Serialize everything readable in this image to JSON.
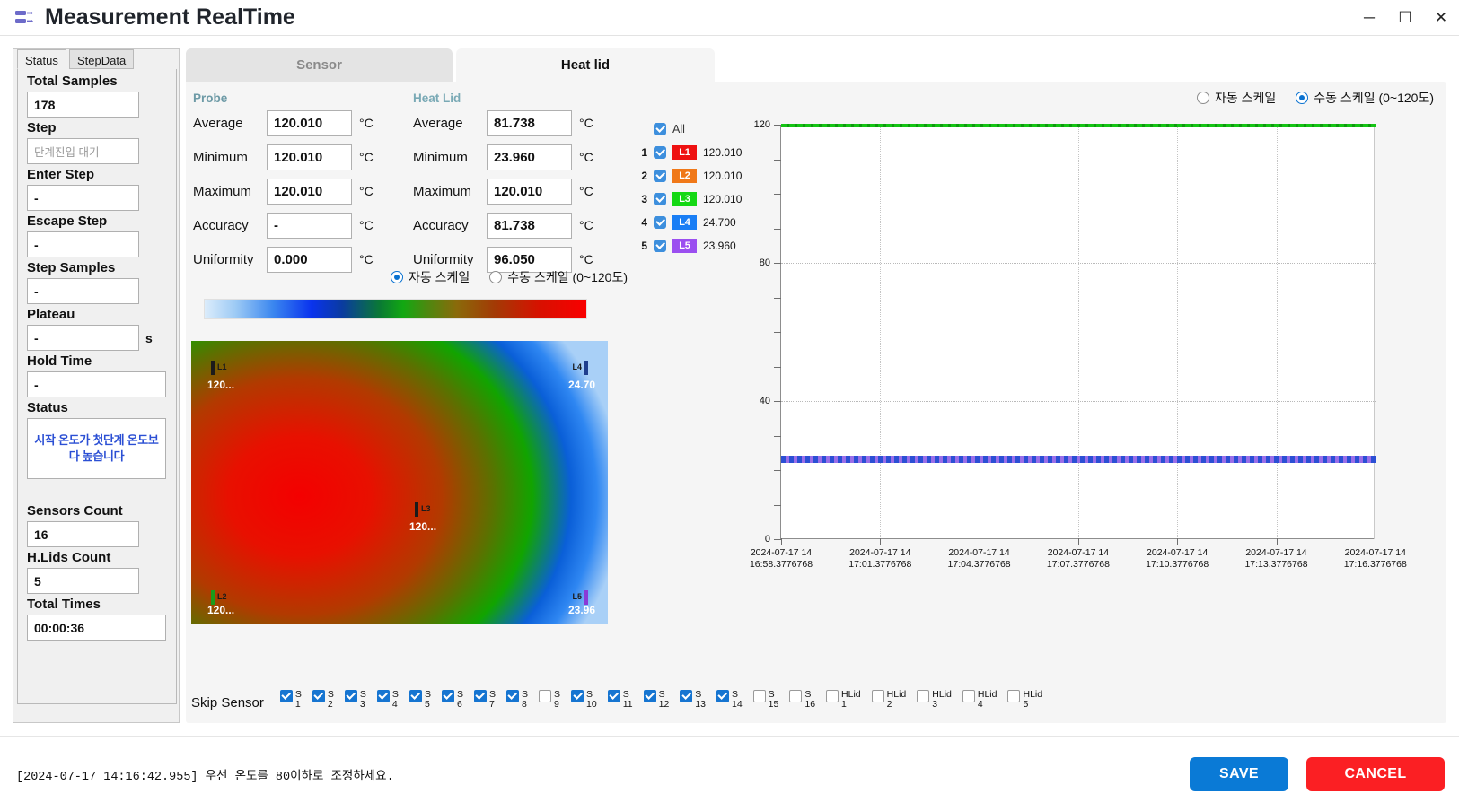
{
  "window": {
    "title": "Measurement RealTime",
    "icon": "devices-icon",
    "minimize": "─",
    "maximize": "☐",
    "close": "✕"
  },
  "sidebar": {
    "tabs": [
      {
        "label": "Status",
        "active": true
      },
      {
        "label": "StepData",
        "active": false
      }
    ],
    "fields": [
      {
        "label": "Total Samples",
        "value": "178",
        "placeholder": "",
        "unit": ""
      },
      {
        "label": "Step",
        "value": "",
        "placeholder": "단계진입 대기",
        "unit": ""
      },
      {
        "label": "Enter Step",
        "value": "-",
        "placeholder": "",
        "unit": ""
      },
      {
        "label": "Escape Step",
        "value": "-",
        "placeholder": "",
        "unit": ""
      },
      {
        "label": "Step Samples",
        "value": "-",
        "placeholder": "",
        "unit": ""
      },
      {
        "label": "Plateau",
        "value": "-",
        "placeholder": "",
        "unit": "s"
      },
      {
        "label": "Hold Time",
        "value": "-",
        "placeholder": "",
        "unit": ""
      }
    ],
    "status": {
      "label": "Status",
      "message": "시작 온도가 첫단계 온도보다 높습니다",
      "color": "#2b4fd4"
    },
    "counts": [
      {
        "label": "Sensors Count",
        "value": "16"
      },
      {
        "label": "H.Lids Count",
        "value": "5"
      },
      {
        "label": "Total Times",
        "value": "00:00:36"
      }
    ]
  },
  "tabs": [
    {
      "label": "Sensor",
      "active": false
    },
    {
      "label": "Heat lid",
      "active": true
    }
  ],
  "stats": {
    "probe": {
      "group": "Probe",
      "unit": "°C",
      "rows": [
        {
          "name": "Average",
          "value": "120.010"
        },
        {
          "name": "Minimum",
          "value": "120.010"
        },
        {
          "name": "Maximum",
          "value": "120.010"
        },
        {
          "name": "Accuracy",
          "value": "-"
        },
        {
          "name": "Uniformity",
          "value": "0.000"
        }
      ]
    },
    "heatlid": {
      "group": "Heat Lid",
      "unit": "°C",
      "rows": [
        {
          "name": "Average",
          "value": "81.738"
        },
        {
          "name": "Minimum",
          "value": "23.960"
        },
        {
          "name": "Maximum",
          "value": "120.010"
        },
        {
          "name": "Accuracy",
          "value": "81.738"
        },
        {
          "name": "Uniformity",
          "value": "96.050"
        }
      ]
    }
  },
  "scale_radios_heatmap": {
    "auto": {
      "label": "자동 스케일",
      "selected": true
    },
    "manual": {
      "label": "수동 스케일 (0~120도)",
      "selected": false
    }
  },
  "scale_radios_chart": {
    "auto": {
      "label": "자동 스케일",
      "selected": false
    },
    "manual": {
      "label": "수동 스케일 (0~120도)",
      "selected": true
    }
  },
  "legend": {
    "all_label": "All",
    "all_checked": true,
    "items": [
      {
        "index": "1",
        "name": "L1",
        "value": "120.010",
        "color": "#ee1111",
        "checked": true
      },
      {
        "index": "2",
        "name": "L2",
        "value": "120.010",
        "color": "#f07818",
        "checked": true
      },
      {
        "index": "3",
        "name": "L3",
        "value": "120.010",
        "color": "#14d814",
        "checked": true
      },
      {
        "index": "4",
        "name": "L4",
        "value": "24.700",
        "color": "#1a7ef5",
        "checked": true
      },
      {
        "index": "5",
        "name": "L5",
        "value": "23.960",
        "color": "#9b4ff0",
        "checked": true
      }
    ]
  },
  "heatmap": {
    "markers": [
      {
        "name": "L1",
        "value": "120...",
        "pos": "top-left",
        "tick_color": "#1b1b1b"
      },
      {
        "name": "L4",
        "value": "24.70",
        "pos": "top-right",
        "tick_color": "#1f3f8f"
      },
      {
        "name": "L3",
        "value": "120...",
        "pos": "center",
        "tick_color": "#1b1b1b"
      },
      {
        "name": "L2",
        "value": "120...",
        "pos": "bottom-left",
        "tick_color": "#1b9c1b"
      },
      {
        "name": "L5",
        "value": "23.96",
        "pos": "bottom-right",
        "tick_color": "#8a3ad6"
      }
    ]
  },
  "chart_data": {
    "type": "line",
    "title": "",
    "xlabel": "",
    "ylabel": "",
    "ylim": [
      0,
      120
    ],
    "yticks": [
      0,
      40,
      80,
      120
    ],
    "ytick_labels": [
      "0",
      "40",
      "80",
      "120"
    ],
    "grid": true,
    "legend_position": "left-external",
    "x": [
      "2024-07-17 14\n16:58.3776768",
      "2024-07-17 14\n17:01.3776768",
      "2024-07-17 14\n17:04.3776768",
      "2024-07-17 14\n17:07.3776768",
      "2024-07-17 14\n17:10.3776768",
      "2024-07-17 14\n17:13.3776768",
      "2024-07-17 14\n17:16.3776768"
    ],
    "xtick_labels": [
      [
        "2024-07-17 14",
        "16:58.3776768"
      ],
      [
        "2024-07-17 14",
        "17:01.3776768"
      ],
      [
        "2024-07-17 14",
        "17:04.3776768"
      ],
      [
        "2024-07-17 14",
        "17:07.3776768"
      ],
      [
        "2024-07-17 14",
        "17:10.3776768"
      ],
      [
        "2024-07-17 14",
        "17:13.3776768"
      ],
      [
        "2024-07-17 14",
        "17:16.3776768"
      ]
    ],
    "series": [
      {
        "name": "L1",
        "color": "#ee1111",
        "constant": 120.01,
        "values": [
          120.01,
          120.01,
          120.01,
          120.01,
          120.01,
          120.01,
          120.01
        ]
      },
      {
        "name": "L2",
        "color": "#f07818",
        "constant": 120.01,
        "values": [
          120.01,
          120.01,
          120.01,
          120.01,
          120.01,
          120.01,
          120.01
        ]
      },
      {
        "name": "L3",
        "color": "#14d814",
        "constant": 120.01,
        "values": [
          120.01,
          120.01,
          120.01,
          120.01,
          120.01,
          120.01,
          120.01
        ]
      },
      {
        "name": "L4",
        "color": "#1a7ef5",
        "constant": 24.7,
        "values": [
          24.7,
          24.7,
          24.7,
          24.7,
          24.7,
          24.7,
          24.7
        ]
      },
      {
        "name": "L5",
        "color": "#9b4ff0",
        "constant": 23.96,
        "values": [
          23.96,
          23.96,
          23.96,
          23.96,
          23.96,
          23.96,
          23.96
        ]
      }
    ]
  },
  "skip_sensor": {
    "label": "Skip Sensor",
    "items": [
      {
        "prefix": "S",
        "num": "1",
        "checked": true
      },
      {
        "prefix": "S",
        "num": "2",
        "checked": true
      },
      {
        "prefix": "S",
        "num": "3",
        "checked": true
      },
      {
        "prefix": "S",
        "num": "4",
        "checked": true
      },
      {
        "prefix": "S",
        "num": "5",
        "checked": true
      },
      {
        "prefix": "S",
        "num": "6",
        "checked": true
      },
      {
        "prefix": "S",
        "num": "7",
        "checked": true
      },
      {
        "prefix": "S",
        "num": "8",
        "checked": true
      },
      {
        "prefix": "S",
        "num": "9",
        "checked": false
      },
      {
        "prefix": "S",
        "num": "10",
        "checked": true
      },
      {
        "prefix": "S",
        "num": "11",
        "checked": true
      },
      {
        "prefix": "S",
        "num": "12",
        "checked": true
      },
      {
        "prefix": "S",
        "num": "13",
        "checked": true
      },
      {
        "prefix": "S",
        "num": "14",
        "checked": true
      },
      {
        "prefix": "S",
        "num": "15",
        "checked": false
      },
      {
        "prefix": "S",
        "num": "16",
        "checked": false
      },
      {
        "prefix": "HLid",
        "num": "1",
        "checked": false
      },
      {
        "prefix": "HLid",
        "num": "2",
        "checked": false
      },
      {
        "prefix": "HLid",
        "num": "3",
        "checked": false
      },
      {
        "prefix": "HLid",
        "num": "4",
        "checked": false
      },
      {
        "prefix": "HLid",
        "num": "5",
        "checked": false
      }
    ]
  },
  "footer": {
    "log": "[2024-07-17 14:16:42.955] 우선 온도를 80이하로 조정하세요.",
    "save_label": "SAVE",
    "cancel_label": "CANCEL",
    "save_color": "#0a7ad6",
    "cancel_color": "#fb1f23"
  }
}
